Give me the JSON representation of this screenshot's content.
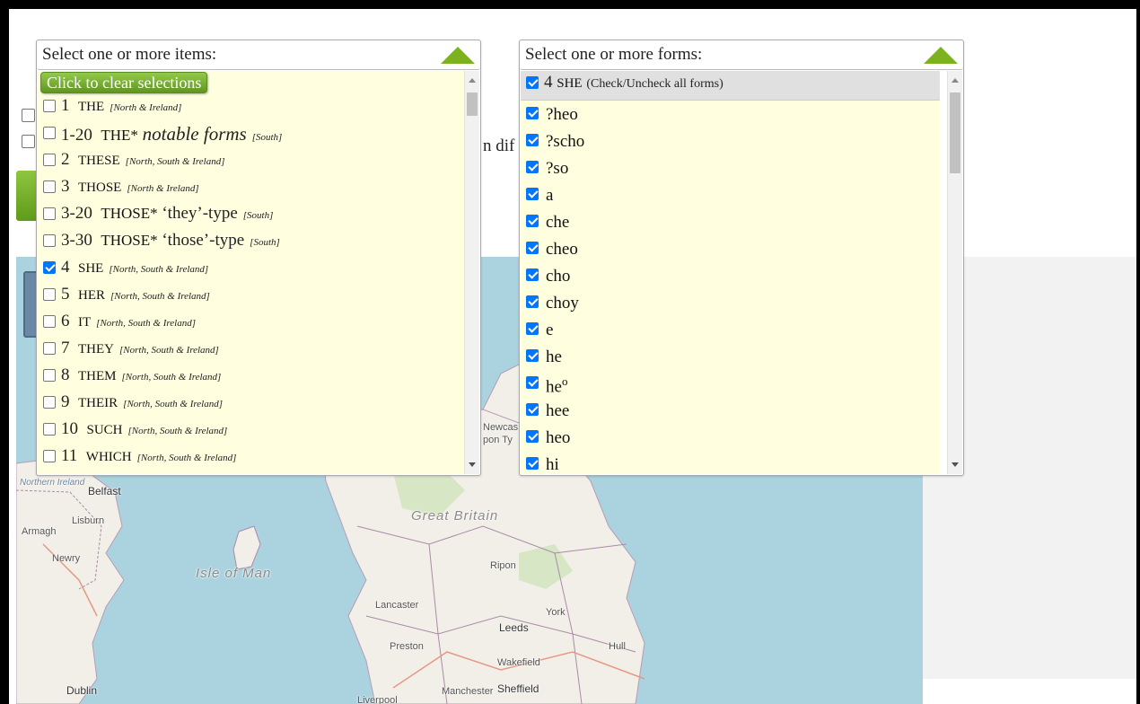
{
  "map": {
    "labels": {
      "northern_ireland": "Northern\nIreland",
      "belfast": "Belfast",
      "lisburn": "Lisburn",
      "armagh": "Armagh",
      "newry": "Newry",
      "isle_of_man": "Isle of Man",
      "great_britain": "Great Britain",
      "newcastle": "Newcas",
      "upon_tyne": "pon Ty",
      "leeds": "Leeds",
      "york": "York",
      "preston": "Preston",
      "wakefield": "Wakefield",
      "lancaster": "Lancaster",
      "ripon": "Ripon",
      "hull": "Hull",
      "dublin": "Dublin",
      "manchester": "Manchester",
      "sheffield": "Sheffield",
      "liverpool": "Liverpool"
    }
  },
  "background": {
    "partial_text": "n dif"
  },
  "items_dropdown": {
    "title": "Select one or more items:",
    "clear_button": "Click to clear selections",
    "items": [
      {
        "num": "1",
        "word": "THE",
        "region": "[North & Ireland]",
        "checked": false
      },
      {
        "num": "1-20",
        "word": "THE*",
        "extra": "notable forms",
        "region": "[South]",
        "checked": false
      },
      {
        "num": "2",
        "word": "THESE",
        "region": "[North, South & Ireland]",
        "checked": false
      },
      {
        "num": "3",
        "word": "THOSE",
        "region": "[North & Ireland]",
        "checked": false
      },
      {
        "num": "3-20",
        "word": "THOSE*",
        "quote": "‘they’-type",
        "region": "[South]",
        "checked": false
      },
      {
        "num": "3-30",
        "word": "THOSE*",
        "quote": "‘those’-type",
        "region": "[South]",
        "checked": false
      },
      {
        "num": "4",
        "word": "SHE",
        "region": "[North, South & Ireland]",
        "checked": true
      },
      {
        "num": "5",
        "word": "HER",
        "region": "[North, South & Ireland]",
        "checked": false
      },
      {
        "num": "6",
        "word": "IT",
        "region": "[North, South & Ireland]",
        "checked": false
      },
      {
        "num": "7",
        "word": "THEY",
        "region": "[North, South & Ireland]",
        "checked": false
      },
      {
        "num": "8",
        "word": "THEM",
        "region": "[North, South & Ireland]",
        "checked": false
      },
      {
        "num": "9",
        "word": "THEIR",
        "region": "[North, South & Ireland]",
        "checked": false
      },
      {
        "num": "10",
        "word": "SUCH",
        "region": "[North, South & Ireland]",
        "checked": false
      },
      {
        "num": "11",
        "word": "WHICH",
        "region": "[North, South & Ireland]",
        "checked": false
      }
    ]
  },
  "forms_dropdown": {
    "title": "Select one or more forms:",
    "header": {
      "num": "4",
      "word": "SHE",
      "note": "(Check/Uncheck all forms)",
      "checked": true
    },
    "forms": [
      {
        "text": "?heo",
        "sup": "",
        "checked": true
      },
      {
        "text": "?scho",
        "sup": "",
        "checked": true
      },
      {
        "text": "?so",
        "sup": "",
        "checked": true
      },
      {
        "text": "a",
        "sup": "",
        "checked": true
      },
      {
        "text": "che",
        "sup": "",
        "checked": true
      },
      {
        "text": "cheo",
        "sup": "",
        "checked": true
      },
      {
        "text": "cho",
        "sup": "",
        "checked": true
      },
      {
        "text": "choy",
        "sup": "",
        "checked": true
      },
      {
        "text": "e",
        "sup": "",
        "checked": true
      },
      {
        "text": "he",
        "sup": "",
        "checked": true
      },
      {
        "text": "he",
        "sup": "o",
        "checked": true
      },
      {
        "text": "hee",
        "sup": "",
        "checked": true
      },
      {
        "text": "heo",
        "sup": "",
        "checked": true
      },
      {
        "text": "hi",
        "sup": "",
        "checked": true
      }
    ]
  },
  "colors": {
    "accent_green": "#7db21f",
    "list_bg": "#ffffe0",
    "checkbox_blue": "#0075ff",
    "sea": "#abd3df"
  }
}
